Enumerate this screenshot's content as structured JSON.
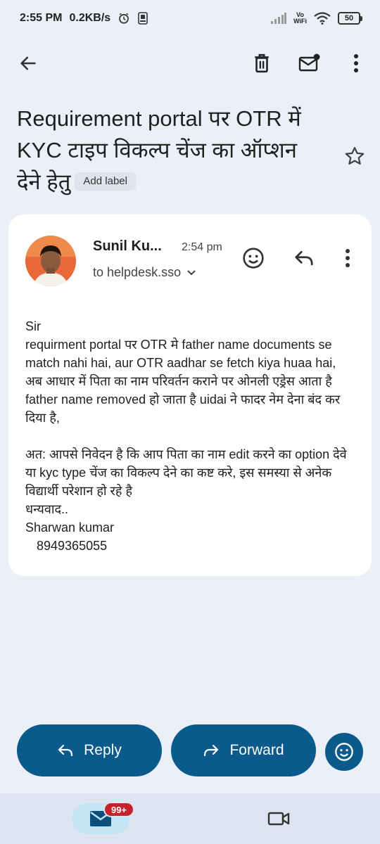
{
  "status": {
    "time": "2:55 PM",
    "speed": "0.2KB/s",
    "vowifi_top": "Vo",
    "vowifi_bottom": "WiFi",
    "battery": "50"
  },
  "toolbar": {
    "back_icon": "arrow-back-icon",
    "delete_icon": "trash-icon",
    "unread_icon": "mark-unread-icon",
    "more_icon": "more-vert-icon"
  },
  "email": {
    "subject": "Requirement portal पर OTR में KYC टाइप विकल्प चेंज का ऑप्शन देने हेतु",
    "add_label": "Add label",
    "sender_name": "Sunil Ku...",
    "time": "2:54 pm",
    "recipient": "to helpdesk.sso",
    "body": {
      "greeting": "Sir",
      "para1": "requirment portal पर OTR मे father name documents se match nahi hai, aur OTR aadhar se fetch kiya huaa hai, अब आधार में पिता का नाम परिवर्तन कराने पर ओनली एड्रेस आता है father name removed हो जाता है uidai ने फादर नेम देना बंद कर दिया है,",
      "para2": "अत: आपसे निवेदन है कि आप पिता का नाम edit करने का option देवे या kyc type चेंज का विकल्प देने का कष्ट करे, इस समस्या से अनेक विद्यार्थी परेशान हो रहे है",
      "thanks": "धन्यवाद..",
      "signature": "Sharwan kumar",
      "phone": "8949365055"
    }
  },
  "actions": {
    "reply": "Reply",
    "forward": "Forward"
  },
  "nav": {
    "mail_badge": "99+"
  },
  "colors": {
    "background": "#eaeff8",
    "card": "#ffffff",
    "action_blue": "#0b5a8c",
    "badge_red": "#c5232c",
    "nav_active": "#c4e5f5"
  }
}
